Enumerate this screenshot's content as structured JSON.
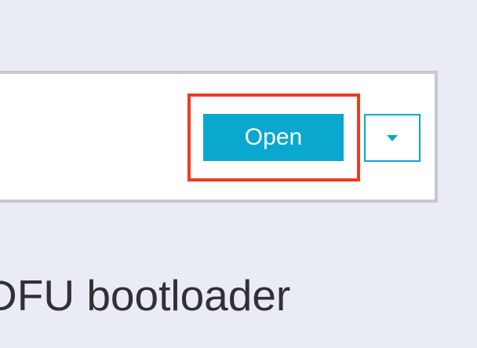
{
  "toolbar": {
    "open_label": "Open"
  },
  "dropdown": {
    "icon": "chevron-down-icon"
  },
  "section": {
    "title": "DFU bootloader"
  },
  "colors": {
    "accent": "#0aa7cf",
    "highlight": "#ee3b1f",
    "page_background": "#e9ecf4",
    "card_border": "#c7c9cc",
    "text_dark": "#2f3136"
  }
}
